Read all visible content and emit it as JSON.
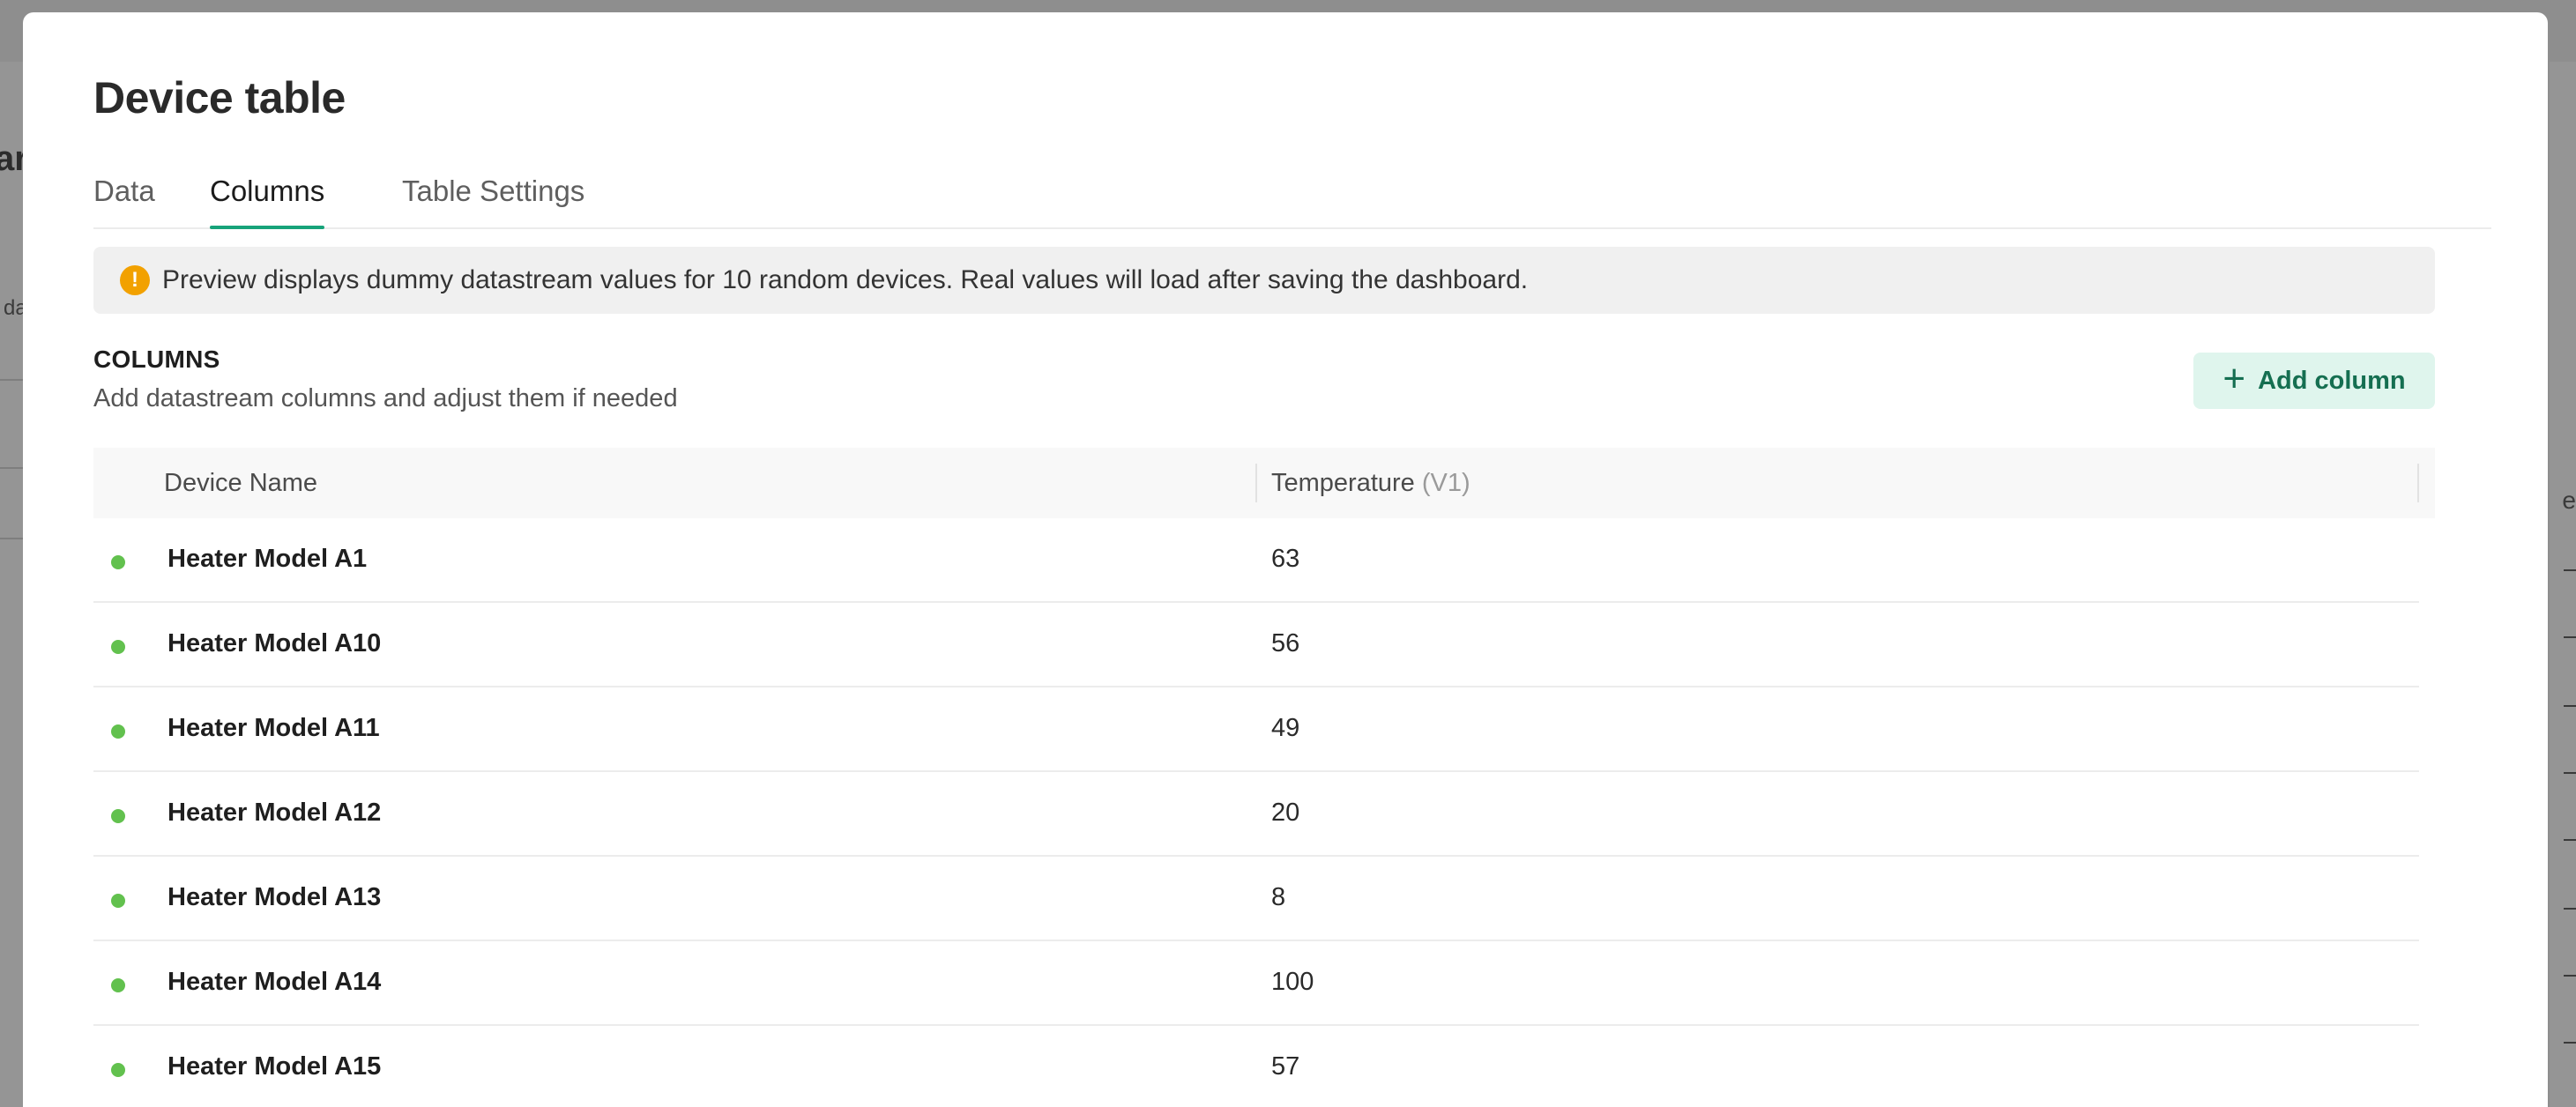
{
  "background": {
    "left_fragment_title": "ar",
    "left_fragment_text": "da",
    "right_fragment_text": "e"
  },
  "modal": {
    "title": "Device table",
    "tabs": [
      {
        "label": "Data",
        "active": false
      },
      {
        "label": "Columns",
        "active": true
      },
      {
        "label": "Table Settings",
        "active": false
      }
    ],
    "notice": {
      "icon": "warning-icon",
      "icon_glyph": "!",
      "text": "Preview displays dummy datastream values for 10 random devices. Real values will load after saving the dashboard."
    },
    "columns_section": {
      "title": "COLUMNS",
      "subtitle": "Add datastream columns and adjust them if needed",
      "add_button": {
        "icon": "plus-icon",
        "icon_glyph": "+",
        "label": "Add column"
      }
    },
    "table": {
      "headers": [
        {
          "label": "Device Name",
          "suffix": ""
        },
        {
          "label": "Temperature",
          "suffix": "(V1)"
        }
      ],
      "rows": [
        {
          "name": "Heater Model A1",
          "value": "63",
          "status": "online"
        },
        {
          "name": "Heater Model A10",
          "value": "56",
          "status": "online"
        },
        {
          "name": "Heater Model A11",
          "value": "49",
          "status": "online"
        },
        {
          "name": "Heater Model A12",
          "value": "20",
          "status": "online"
        },
        {
          "name": "Heater Model A13",
          "value": "8",
          "status": "online"
        },
        {
          "name": "Heater Model A14",
          "value": "100",
          "status": "online"
        },
        {
          "name": "Heater Model A15",
          "value": "57",
          "status": "online"
        }
      ]
    }
  },
  "colors": {
    "accent": "#17a37a",
    "button_bg": "#dff5ed",
    "button_text": "#156f51",
    "status_online": "#62c14e",
    "warning": "#f2a100"
  }
}
